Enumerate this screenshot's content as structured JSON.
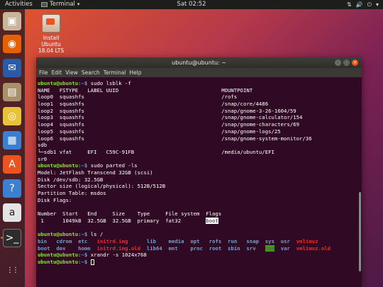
{
  "topbar": {
    "activities": "Activities",
    "app_name": "Terminal",
    "app_caret": "▾",
    "clock": "Sat 02:52",
    "tray": [
      "⇅",
      "🔊",
      "⏻",
      "▾"
    ]
  },
  "dock": {
    "items": [
      {
        "name": "installer-dock-icon",
        "glyph": "▣",
        "bg": "#c8b59b"
      },
      {
        "name": "firefox-icon",
        "glyph": "◉",
        "bg": "#e66000"
      },
      {
        "name": "thunderbird-icon",
        "glyph": "✉",
        "bg": "#2b5aa8"
      },
      {
        "name": "files-icon",
        "glyph": "▤",
        "bg": "#a8906b"
      },
      {
        "name": "rhythmbox-icon",
        "glyph": "◎",
        "bg": "#e8c33a"
      },
      {
        "name": "writer-icon",
        "glyph": "▦",
        "bg": "#3b7fd0"
      },
      {
        "name": "software-icon",
        "glyph": "A",
        "bg": "#e95420"
      },
      {
        "name": "help-icon",
        "glyph": "?",
        "bg": "#3f7fd0"
      },
      {
        "name": "amazon-icon",
        "glyph": "a",
        "bg": "#e4e4e4"
      },
      {
        "name": "terminal-icon",
        "glyph": ">_",
        "bg": "#2c2c2c"
      },
      {
        "name": "show-apps-icon",
        "glyph": "⋮⋮",
        "bg": "transparent"
      }
    ]
  },
  "desktop": {
    "install_label_1": "Install",
    "install_label_2": "Ubuntu",
    "install_label_3": "18.04 LTS"
  },
  "window": {
    "title": "ubuntu@ubuntu: ~",
    "menu": [
      "File",
      "Edit",
      "View",
      "Search",
      "Terminal",
      "Help"
    ]
  },
  "terminal": {
    "prompt_user": "ubuntu@ubuntu",
    "prompt_sep": ":~$ ",
    "cmd1": "sudo lsblk -f",
    "lsblk": [
      "NAME   FSTYPE   LABEL UUID                                 MOUNTPOINT",
      "loop0  squashfs                                            /rofs",
      "loop1  squashfs                                            /snap/core/4486",
      "loop2  squashfs                                            /snap/gnome-3-26-1604/59",
      "loop3  squashfs                                            /snap/gnome-calculator/154",
      "loop4  squashfs                                            /snap/gnome-characters/69",
      "loop5  squashfs                                            /snap/gnome-logs/25",
      "loop6  squashfs                                            /snap/gnome-system-monitor/36",
      "sdb",
      "└─sdb1 vfat     EFI   C59C-91FB                            /media/ubuntu/EFI",
      "sr0"
    ],
    "cmd2": "sudo parted -ls",
    "parted": [
      "Model: JetFlash Transcend 32GB (scsi)",
      "Disk /dev/sdb: 32.5GB",
      "Sector size (logical/physical): 512B/512B",
      "Partition Table: msdos",
      "Disk Flags:",
      "",
      "Number  Start   End     Size    Type     File system  Flags"
    ],
    "part_row": " 1      1049kB  32.5GB  32.5GB  primary  fat32        ",
    "part_flag": "boot",
    "cmd3": "ls /",
    "ls_row1": [
      {
        "t": "bin",
        "c": "dir"
      },
      {
        "t": "   cdrom",
        "c": "dir"
      },
      {
        "t": "  etc",
        "c": "dir"
      },
      {
        "t": "   ",
        "c": ""
      },
      {
        "t": "initrd.img",
        "c": "red"
      },
      {
        "t": "      lib",
        "c": "dir"
      },
      {
        "t": "    media",
        "c": "dir"
      },
      {
        "t": "  opt",
        "c": "dir"
      },
      {
        "t": "   rofs",
        "c": "dir"
      },
      {
        "t": "  run",
        "c": "dir"
      },
      {
        "t": "   snap",
        "c": "dir"
      },
      {
        "t": "  sys",
        "c": "dir"
      },
      {
        "t": "  usr",
        "c": "dir"
      },
      {
        "t": "  ",
        "c": ""
      },
      {
        "t": "vmlinuz",
        "c": "red"
      }
    ],
    "ls_row2": [
      {
        "t": "boot",
        "c": "dir"
      },
      {
        "t": "  dev",
        "c": "dir"
      },
      {
        "t": "    home",
        "c": "dir"
      },
      {
        "t": "  ",
        "c": ""
      },
      {
        "t": "initrd.img.old",
        "c": "red"
      },
      {
        "t": "  lib64",
        "c": "dir"
      },
      {
        "t": "  mnt",
        "c": "dir"
      },
      {
        "t": "    proc",
        "c": "dir"
      },
      {
        "t": "  root",
        "c": "dir"
      },
      {
        "t": "  sbin",
        "c": "dir"
      },
      {
        "t": "  srv",
        "c": "dir"
      },
      {
        "t": "   ",
        "c": ""
      },
      {
        "t": "tmp",
        "c": "hl"
      },
      {
        "t": "  var",
        "c": "dir"
      },
      {
        "t": "  ",
        "c": ""
      },
      {
        "t": "vmlinuz.old",
        "c": "red"
      }
    ],
    "cmd4": "xrandr -s 1024x768"
  },
  "colors": {
    "accent": "#e95420",
    "terminal_bg": "#300a24",
    "prompt": "#8ae234",
    "path": "#729fcf"
  }
}
